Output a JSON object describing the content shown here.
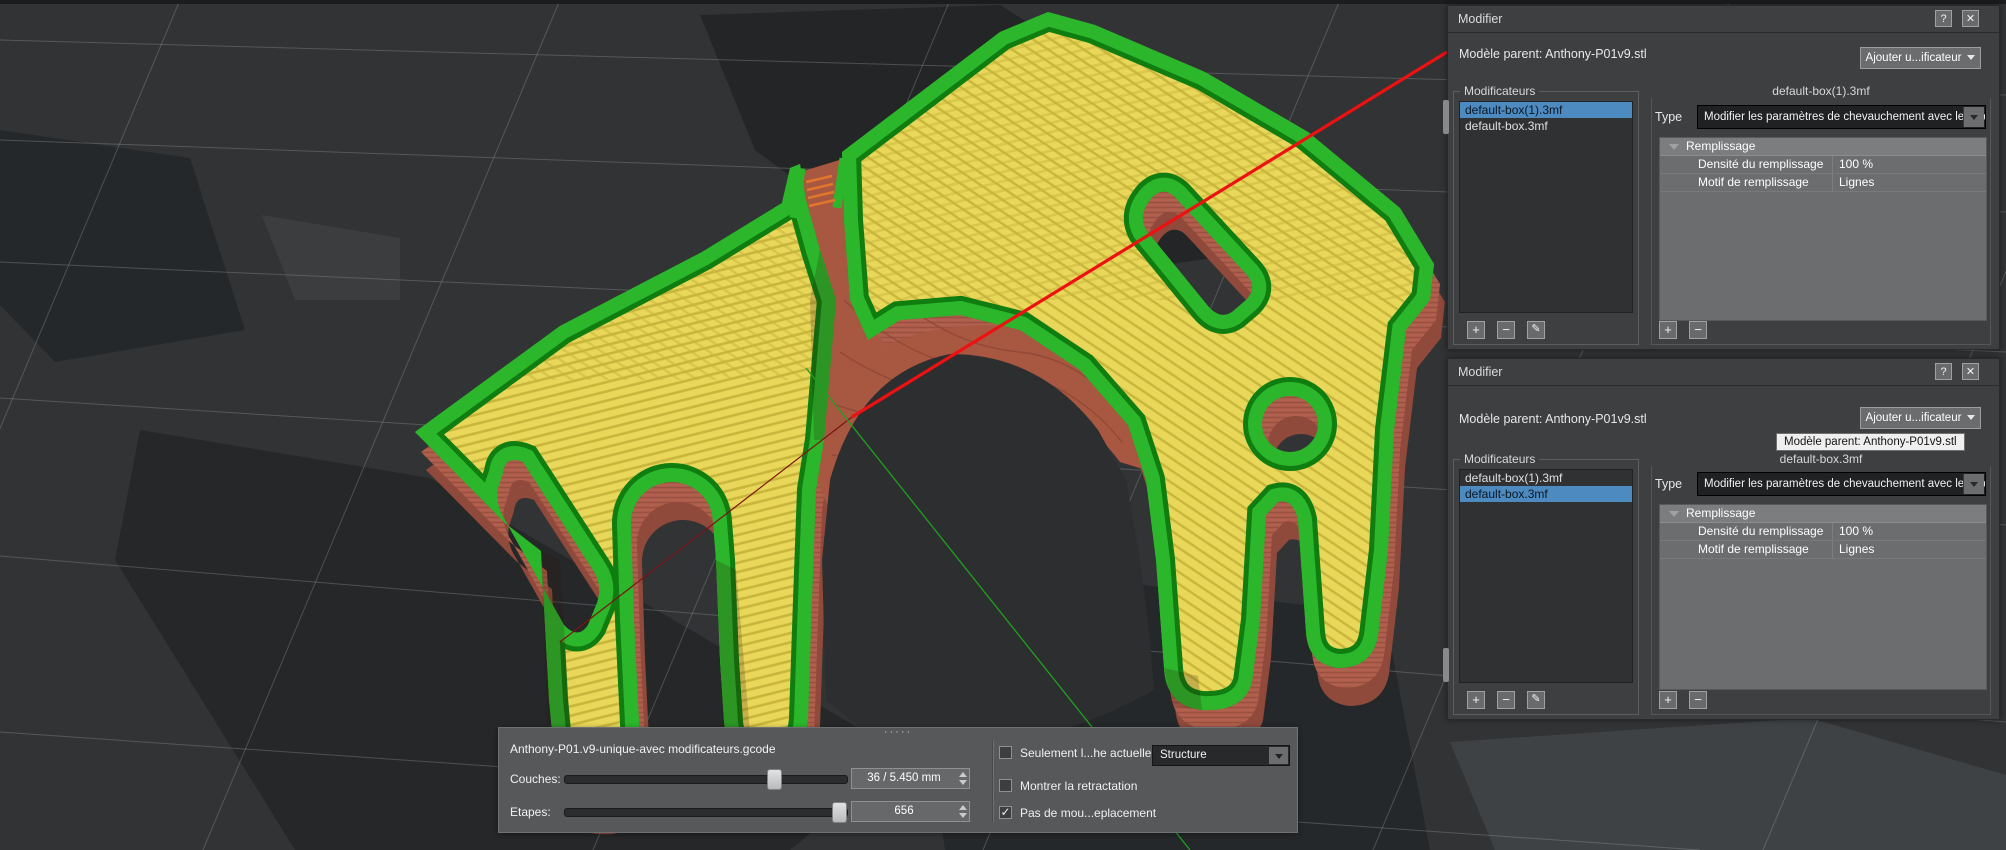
{
  "viewport": {
    "grid_color": "#9aa0a4",
    "axes": {
      "x_color": "#ee1111",
      "x_dark": "#7c1414",
      "y_color": "#1fa01f"
    },
    "model": {
      "name": "gcode-preview-model",
      "wall": "#b2604e",
      "wall_dark": "#8f4a3b",
      "saddle": "#a85741",
      "saddle_line": "#8f4736",
      "top_green": "#2bb62b",
      "green_dark": "#0f7d0f",
      "infill_yellow": "#e9d75a",
      "infill_line": "#c8b63c",
      "bridge_orange": "#e0772b"
    }
  },
  "panels": [
    {
      "title": "Modifier",
      "help_glyph": "?",
      "close_glyph": "✕",
      "parent_label": "Modèle parent: Anthony-P01v9.stl",
      "add_button": "Ajouter u...ificateur",
      "modifiers_group": "Modificateurs",
      "modifiers": [
        {
          "name": "default-box(1).3mf"
        },
        {
          "name": "default-box.3mf"
        }
      ],
      "selected_index": 0,
      "settings_title": "default-box(1).3mf",
      "type_label": "Type",
      "type_value": "Modifier les paramètres de chevauchement avec le modè",
      "section": "Remplissage",
      "properties": [
        {
          "name": "Densité du remplissage",
          "value": "100 %"
        },
        {
          "name": "Motif de remplissage",
          "value": "Lignes"
        }
      ],
      "add_glyph": "+",
      "remove_glyph": "−",
      "edit_glyph": "✎"
    },
    {
      "title": "Modifier",
      "help_glyph": "?",
      "close_glyph": "✕",
      "parent_label": "Modèle parent: Anthony-P01v9.stl",
      "add_button": "Ajouter u...ificateur",
      "modifiers_group": "Modificateurs",
      "modifiers": [
        {
          "name": "default-box(1).3mf"
        },
        {
          "name": "default-box.3mf"
        }
      ],
      "selected_index": 1,
      "settings_title": "default-box.3mf",
      "type_label": "Type",
      "type_value": "Modifier les paramètres de chevauchement avec le modè",
      "section": "Remplissage",
      "properties": [
        {
          "name": "Densité du remplissage",
          "value": "100 %"
        },
        {
          "name": "Motif de remplissage",
          "value": "Lignes"
        }
      ],
      "add_glyph": "+",
      "remove_glyph": "−",
      "edit_glyph": "✎"
    }
  ],
  "tooltip": {
    "text": "Modèle parent: Anthony-P01v9.stl"
  },
  "toolbar": {
    "handle": "·····",
    "filename": "Anthony-P01.v9-unique-avec modificateurs.gcode",
    "layers_label": "Couches:",
    "layers_value": "36 / 5.450 mm",
    "steps_label": "Etapes:",
    "steps_value": "656",
    "check_glyph": "✓",
    "checkboxes": [
      {
        "label": "Seulement l...he actuelle",
        "checked": false
      },
      {
        "label": "Montrer la retractation",
        "checked": false
      },
      {
        "label": "Pas de mou...eplacement",
        "checked": true
      }
    ],
    "view_mode": "Structure"
  }
}
